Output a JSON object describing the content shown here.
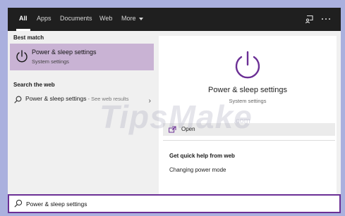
{
  "tabs": [
    {
      "label": "All",
      "active": true
    },
    {
      "label": "Apps"
    },
    {
      "label": "Documents"
    },
    {
      "label": "Web"
    },
    {
      "label": "More"
    }
  ],
  "icons": {
    "feedback": "feedback-icon",
    "more_options": "more-options-icon",
    "power": "power-icon",
    "search": "search-icon",
    "open": "open-icon",
    "chevron": "chevron-right-icon"
  },
  "best_match": {
    "heading": "Best match",
    "title": "Power & sleep settings",
    "subtitle": "System settings"
  },
  "search_web": {
    "heading": "Search the web",
    "query": "Power & sleep settings",
    "suffix": " - See web results"
  },
  "preview": {
    "title": "Power & sleep settings",
    "subtitle": "System settings",
    "open_label": "Open",
    "help_heading": "Get quick help from web",
    "help_link": "Changing power mode"
  },
  "search_box": {
    "value": "Power & sleep settings"
  },
  "watermark": {
    "text": "TipsMake",
    "suffix": ".com"
  },
  "colors": {
    "accent": "#6b2f95",
    "highlight": "#c9b3d4",
    "topbar": "#1f1f1f",
    "frame": "#aab0de"
  }
}
